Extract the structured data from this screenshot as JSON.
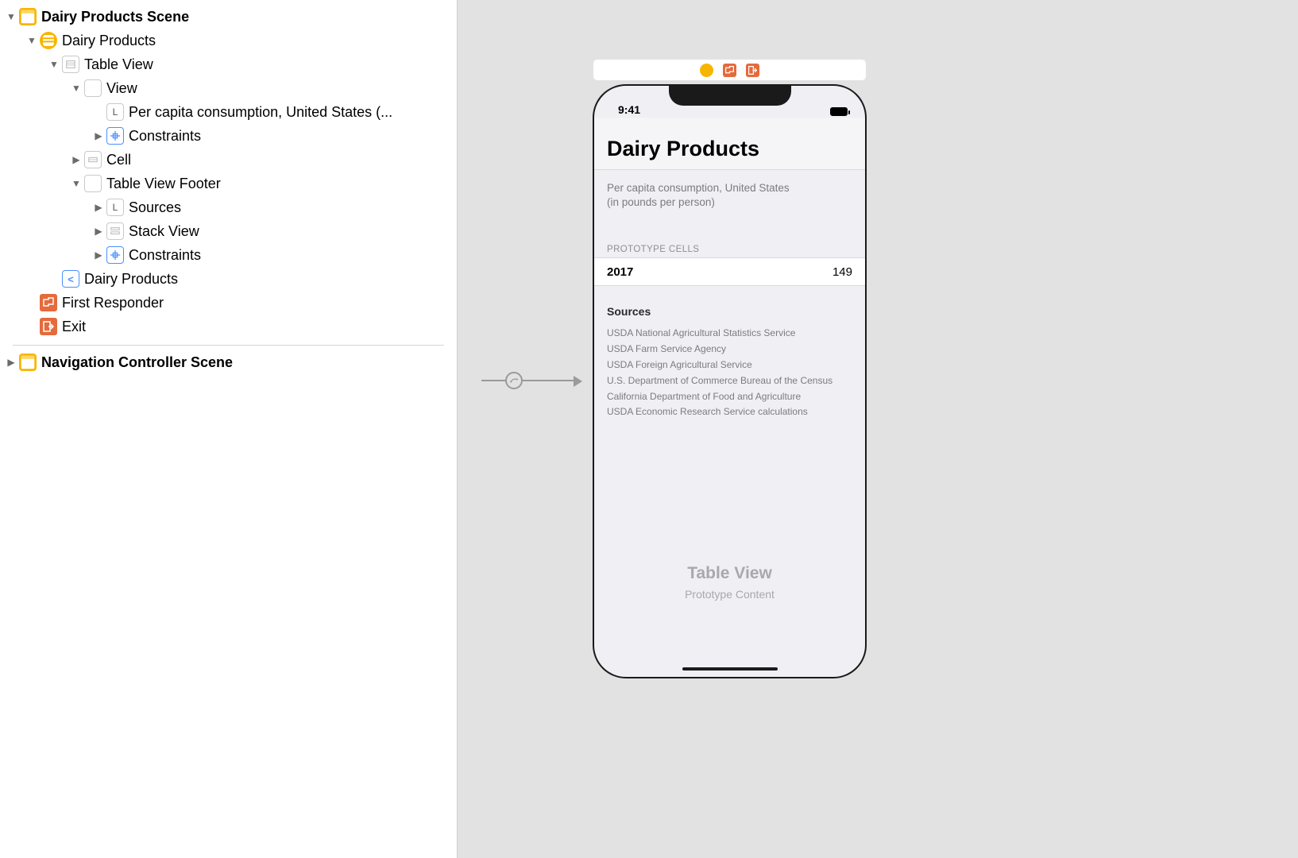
{
  "outline": {
    "scene_root": "Dairy Products Scene",
    "vc": "Dairy Products",
    "table_view": "Table View",
    "header_view": "View",
    "header_label": "Per capita consumption, United States  (...",
    "constraints": "Constraints",
    "cell": "Cell",
    "footer": "Table View Footer",
    "sources": "Sources",
    "stack_view": "Stack View",
    "constraints2": "Constraints",
    "nav_item": "Dairy Products",
    "first_responder": "First Responder",
    "exit": "Exit",
    "nav_scene": "Navigation Controller Scene"
  },
  "phone": {
    "status_time": "9:41",
    "title": "Dairy Products",
    "subtitle_line1": "Per capita consumption, United States",
    "subtitle_line2": "(in pounds per person)",
    "section_header": "PROTOTYPE CELLS",
    "row_year": "2017",
    "row_value": "149",
    "sources_title": "Sources",
    "sources": [
      "USDA National Agricultural Statistics Service",
      "USDA Farm Service Agency",
      "USDA Foreign Agricultural Service",
      "U.S. Department of Commerce Bureau of the Census",
      "California Department of Food and Agriculture",
      "USDA Economic Research Service calculations"
    ],
    "placeholder_title": "Table View",
    "placeholder_sub": "Prototype Content"
  }
}
